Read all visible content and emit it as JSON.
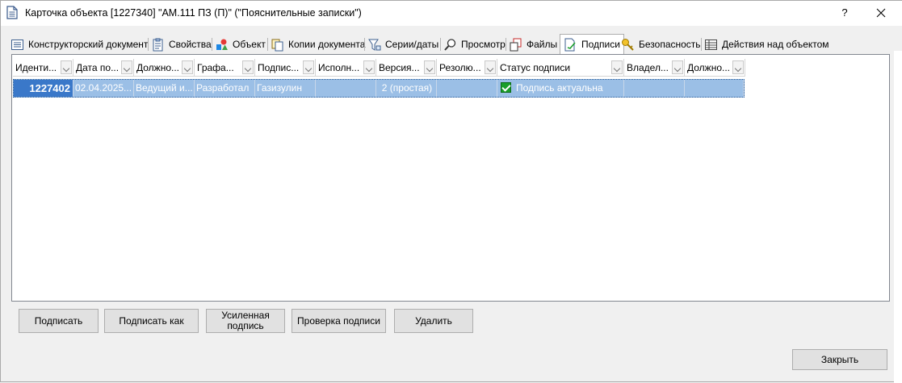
{
  "window": {
    "title": "Карточка объекта [1227340] \"АМ.111 ПЗ (П)\" (\"Пояснительные записки\")",
    "help_label": "?",
    "close_icon": "close-icon"
  },
  "tabs": [
    {
      "label": "Конструкторский документ",
      "icon": "document-form-icon",
      "active": false
    },
    {
      "label": "Свойства",
      "icon": "properties-icon",
      "active": false
    },
    {
      "label": "Объект",
      "icon": "object-icon",
      "active": false
    },
    {
      "label": "Копии документа",
      "icon": "copies-icon",
      "active": false
    },
    {
      "label": "Серии/даты",
      "icon": "filter-icon",
      "active": false
    },
    {
      "label": "Просмотр",
      "icon": "magnifier-icon",
      "active": false
    },
    {
      "label": "Файлы",
      "icon": "files-icon",
      "active": false
    },
    {
      "label": "Подписи",
      "icon": "signature-icon",
      "active": true
    },
    {
      "label": "Безопасность",
      "icon": "key-icon",
      "active": false
    },
    {
      "label": "Действия над объектом",
      "icon": "actions-table-icon",
      "active": false
    }
  ],
  "grid": {
    "columns": [
      "Иденти...",
      "Дата по...",
      "Должно...",
      "Графа...",
      "Подпис...",
      "Исполн...",
      "Версия...",
      "Резолю...",
      "Статус подписи",
      "Владел...",
      "Должно..."
    ],
    "rows": [
      {
        "id": "1227402",
        "date": "02.04.2025...",
        "position": "Ведущий и...",
        "column": "Разработал",
        "signer": "Газизулин",
        "executor": "",
        "version": "2 (простая)",
        "resolution": "",
        "status": "Подпись актуальна",
        "owner": "",
        "owner_position": ""
      }
    ]
  },
  "buttons": {
    "sign": "Подписать",
    "sign_as": "Подписать как",
    "enhanced_line1": "Усиленная",
    "enhanced_line2": "подпись",
    "verify": "Проверка подписи",
    "delete": "Удалить",
    "close": "Закрыть"
  },
  "colors": {
    "selection": "#9bbfe6",
    "selection_key": "#3a78c9",
    "status_ok": "#1a9e2b"
  }
}
